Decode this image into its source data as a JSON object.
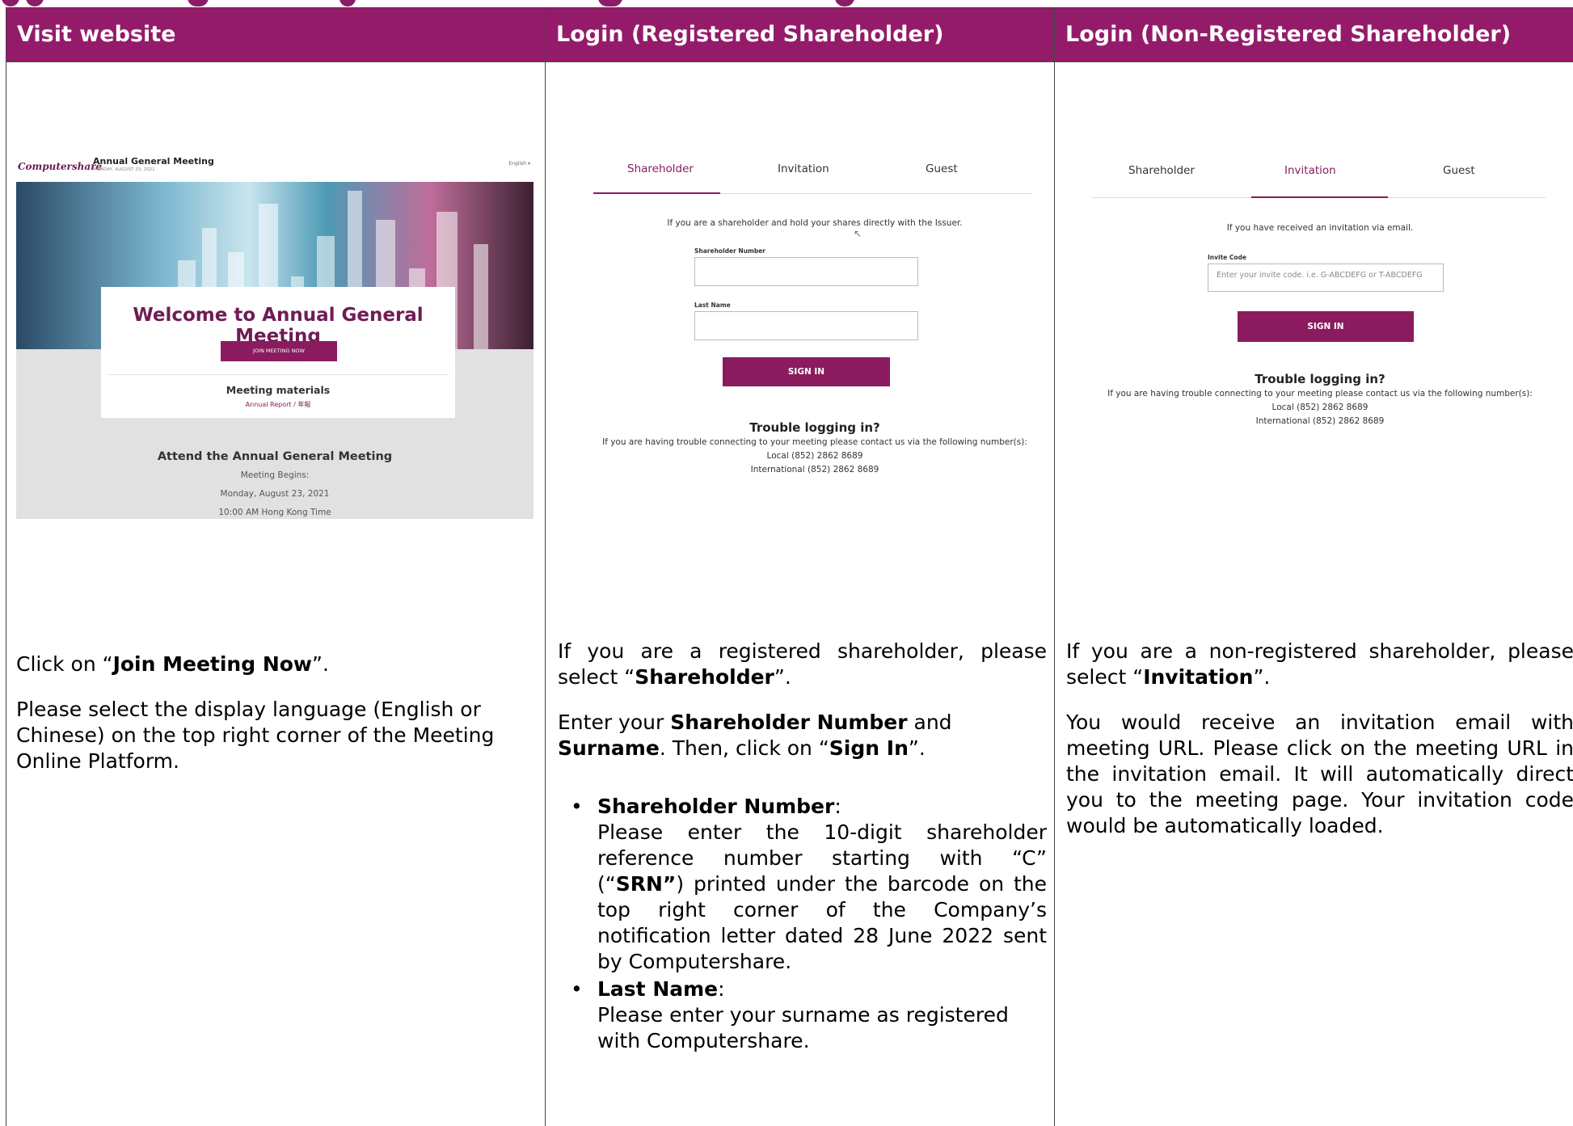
{
  "columns": [
    {
      "header": "Visit website"
    },
    {
      "header": "Login (Registered Shareholder)"
    },
    {
      "header": "Login (Non-Registered Shareholder)"
    }
  ],
  "visit_shot": {
    "logo": "Computershare",
    "title": "Annual General Meeting",
    "date": "MONDAY, AUGUST 23, 2021",
    "language": "English ▾",
    "welcome": "Welcome to Annual General Meeting",
    "join_button": "JOIN MEETING NOW",
    "materials_title": "Meeting materials",
    "annual_report": "Annual Report / 年報",
    "attend_title": "Attend the Annual General Meeting",
    "meeting_begins": "Meeting Begins:",
    "meeting_date": "Monday, August 23, 2021",
    "meeting_time": "10:00 AM Hong Kong Time"
  },
  "reg_shot": {
    "tabs": [
      "Shareholder",
      "Invitation",
      "Guest"
    ],
    "intro": "If you are a shareholder and hold your shares directly with the Issuer.",
    "field1_label": "Shareholder Number",
    "field2_label": "Last Name",
    "sign_in": "SIGN IN",
    "trouble_title": "Trouble logging in?",
    "trouble_text": "If you are having trouble connecting to your meeting please contact us via the following number(s):",
    "local": "Local (852) 2862 8689",
    "international": "International (852) 2862 8689"
  },
  "nonreg_shot": {
    "tabs": [
      "Shareholder",
      "Invitation",
      "Guest"
    ],
    "intro": "If you have received an invitation via email.",
    "field_label": "Invite Code",
    "field_placeholder": "Enter your invite code. i.e. G-ABCDEFG or T-ABCDEFG",
    "sign_in": "SIGN IN",
    "trouble_title": "Trouble logging in?",
    "trouble_text": "If you are having trouble connecting to your meeting please contact us via the following number(s):",
    "local": "Local (852) 2862 8689",
    "international": "International (852) 2862 8689"
  },
  "col1_text": {
    "p1_a": "Click on “",
    "p1_b": "Join Meeting Now",
    "p1_c": "”.",
    "p2": "Please select the display language (English or Chinese) on the top right corner of the Meeting Online Platform."
  },
  "col2_text": {
    "p1_a": "If you are a registered shareholder, please select “",
    "p1_b": "Shareholder",
    "p1_c": "”.",
    "p2_a": "Enter your ",
    "p2_b": "Shareholder Number",
    "p2_c": " and ",
    "p2_d": "Surname",
    "p2_e": ". Then, click on “",
    "p2_f": "Sign In",
    "p2_g": "”.",
    "b1_title": "Shareholder Number",
    "b1_colon": ":",
    "b1_a": "Please enter the 10-digit shareholder reference number starting with “C” (“",
    "b1_b": "SRN”",
    "b1_c": ") printed under the barcode on the top right corner of the Company’s notification letter dated 28 June 2022 sent by Computershare.",
    "b2_title": "Last Name",
    "b2_colon": ":",
    "b2_text": "Please enter your surname as registered with Computershare."
  },
  "col3_text": {
    "p1_a": "If you are a non-registered shareholder, please select “",
    "p1_b": "Invitation",
    "p1_c": "”.",
    "p2": "You would receive an invitation email with meeting URL. Please click on the meeting URL in the invitation email. It will automatically direct you to the meeting page. Your invitation code would be automatically loaded."
  }
}
